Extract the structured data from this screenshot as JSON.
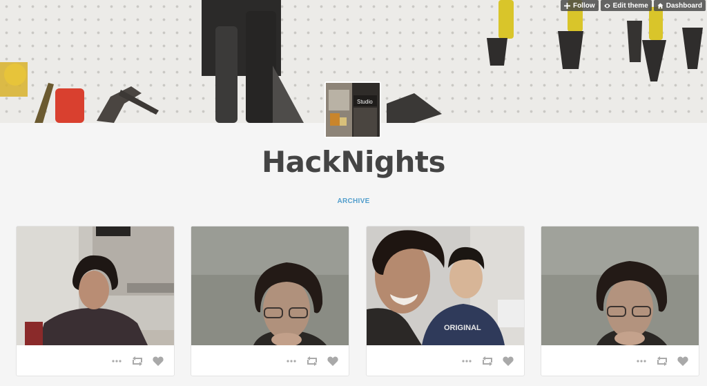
{
  "header": {
    "controls": [
      {
        "label": "Follow",
        "icon": "plus-icon"
      },
      {
        "label": "Edit theme",
        "icon": "eye-icon"
      },
      {
        "label": "Dashboard",
        "icon": "home-icon"
      }
    ],
    "avatar_label": "Studio"
  },
  "blog": {
    "title": "HackNights",
    "archive_label": "ARCHIVE"
  },
  "posts": [
    {
      "subject": "curly-haired man seated in office",
      "actions": [
        "more-icon",
        "reblog-icon",
        "heart-icon"
      ]
    },
    {
      "subject": "man with glasses hand on chin",
      "actions": [
        "more-icon",
        "reblog-icon",
        "heart-icon"
      ]
    },
    {
      "subject": "two men selfie smiling",
      "actions": [
        "more-icon",
        "reblog-icon",
        "heart-icon"
      ]
    },
    {
      "subject": "man with glasses hand on chin",
      "actions": [
        "more-icon",
        "reblog-icon",
        "heart-icon"
      ]
    }
  ],
  "colors": {
    "background": "#f5f5f5",
    "title": "#444444",
    "link": "#529ecc",
    "control_bg": "#464646",
    "icon": "#a9a9a9"
  }
}
